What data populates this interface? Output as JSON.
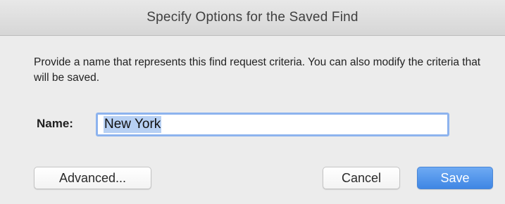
{
  "dialog": {
    "title": "Specify Options for the Saved Find",
    "description": "Provide a name that represents this find request criteria. You can also modify the criteria that will be saved.",
    "name_label": "Name:",
    "name_value": "New York"
  },
  "buttons": {
    "advanced": "Advanced...",
    "cancel": "Cancel",
    "save": "Save"
  },
  "colors": {
    "primary_button": "#3f86e4",
    "focus_ring": "#8db3ee",
    "selection": "#b7d0f3"
  }
}
